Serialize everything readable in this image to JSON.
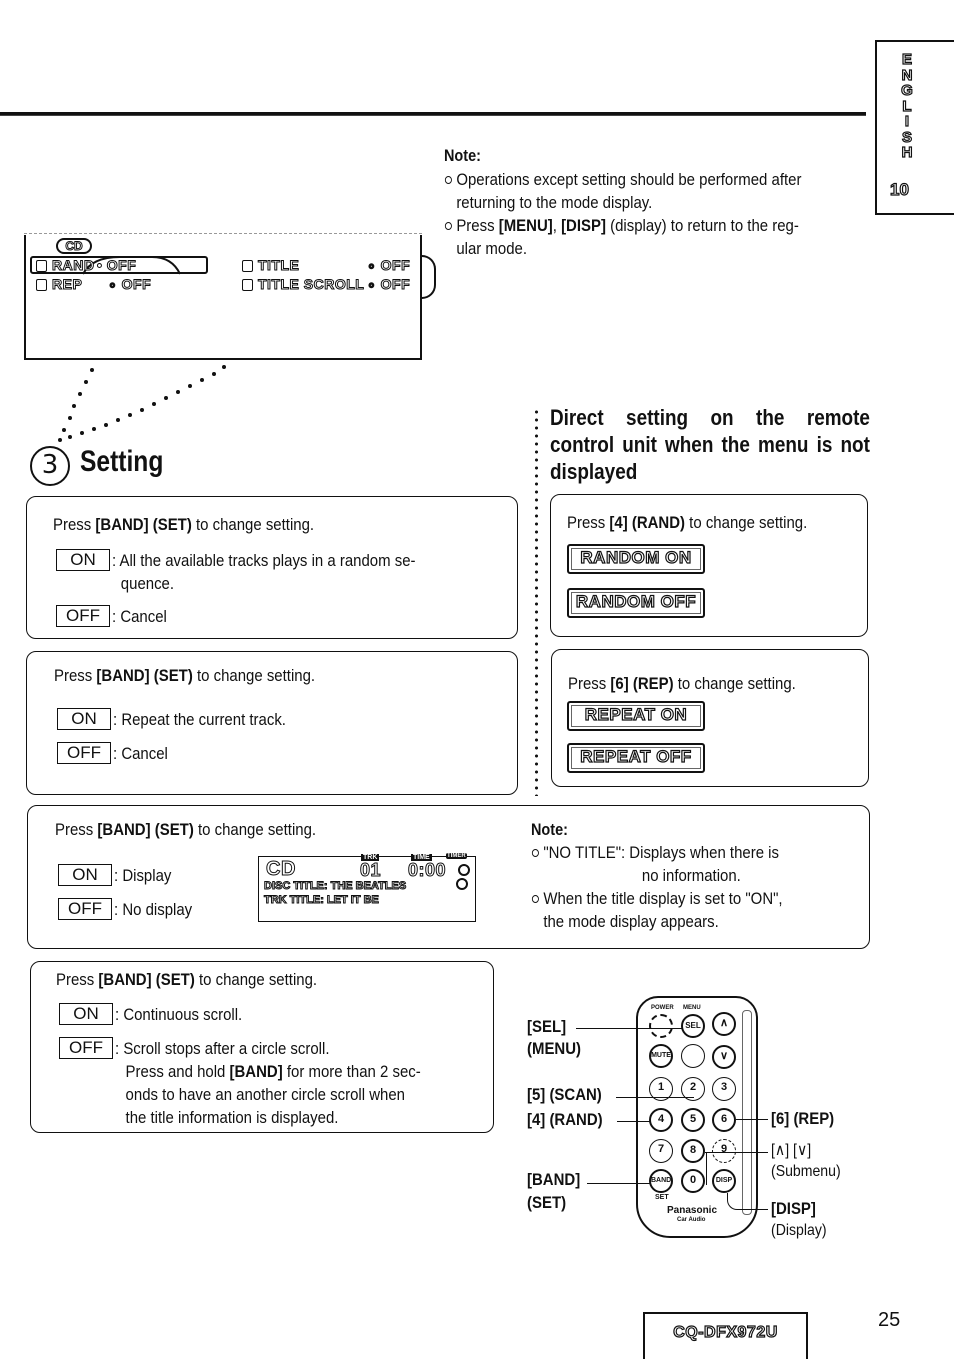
{
  "side_tab": {
    "letters": [
      "E",
      "N",
      "G",
      "L",
      "I",
      "S",
      "H"
    ],
    "page": "10"
  },
  "top_note": {
    "title": "Note:",
    "items": [
      "Operations except setting should be performed after returning to the mode display.",
      "Press [MENU], [DISP] (display) to return to the regular mode."
    ],
    "item2_parts": {
      "pre": "Press ",
      "b1": "[MENU]",
      "mid": ", ",
      "b2": "[DISP]",
      "post": " (display) to return to the reg-",
      "line2": "ular mode."
    },
    "item1_lines": [
      "Operations except setting should be performed after",
      "returning to the mode display."
    ]
  },
  "menu_lcd": {
    "cd": "CD",
    "rand": "RAND",
    "rand_value": "• OFF",
    "rep": "REP",
    "rep_value": "OFF",
    "title": "TITLE",
    "title_value": "OFF",
    "title_scroll": "TITLE SCROLL",
    "title_scroll_value": "OFF"
  },
  "section": {
    "number": "3",
    "title": "Setting"
  },
  "remote_heading": "Direct setting on the remote control unit when the menu is not displayed",
  "boxes": {
    "rand": {
      "press_pre": "Press ",
      "press_b": "[BAND] (SET)",
      "press_post": " to change setting.",
      "on_tag": "ON",
      "on_text": ": All the available tracks plays in a random se-",
      "on_text2": "quence.",
      "off_tag": "OFF",
      "off_text": ": Cancel"
    },
    "rep": {
      "press_pre": "Press ",
      "press_b": "[BAND] (SET)",
      "press_post": " to change setting.",
      "on_tag": "ON",
      "on_text": ": Repeat the current track.",
      "off_tag": "OFF",
      "off_text": ": Cancel"
    },
    "title": {
      "press_pre": "Press ",
      "press_b": "[BAND] (SET)",
      "press_post": " to change setting.",
      "on_tag": "ON",
      "on_text": ": Display",
      "off_tag": "OFF",
      "off_text": ": No display"
    },
    "scroll": {
      "press_pre": "Press ",
      "press_b": "[BAND] (SET)",
      "press_post": " to change setting.",
      "on_tag": "ON",
      "on_text": ": Continuous scroll.",
      "off_tag": "OFF",
      "off_text": ":  Scroll stops after a circle scroll.",
      "off_l2_pre": "Press and hold ",
      "off_l2_b": "[BAND]",
      "off_l2_post": " for more than 2 sec-",
      "off_l3": "onds to have an another circle scroll when",
      "off_l4": "the title information is displayed."
    },
    "remote_rand": {
      "press_pre": "Press ",
      "press_b": "[4] (RAND)",
      "press_post": " to change setting.",
      "lcd_on": "RANDOM ON",
      "lcd_off": "RANDOM OFF"
    },
    "remote_rep": {
      "press_pre": "Press ",
      "press_b": "[6] (REP)",
      "press_post": " to change setting.",
      "lcd_on": "REPEAT ON",
      "lcd_off": "REPEAT OFF"
    }
  },
  "title_lcd": {
    "cd": "CD",
    "trk_label": "TRK",
    "track": "01",
    "time_label": "TIME",
    "time": "0:00",
    "corner": "TIMER",
    "line1": "DISC TITLE: THE BEATLES",
    "line2": "TRK TITLE: LET IT BE"
  },
  "title_note": {
    "title": "Note:",
    "item1_a": "\"NO TITLE\": Displays  when  there  is",
    "item1_b": "no information.",
    "item2_a": "When the title display is set to \"ON\",",
    "item2_b": "the mode display appears."
  },
  "remote": {
    "labels": {
      "sel": "[SEL]",
      "menu": "(MENU)",
      "scan": "[5] (SCAN)",
      "rand": "[4] (RAND)",
      "band": "[BAND]",
      "set": "(SET)",
      "rep": "[6] (REP)",
      "updown": "[∧] [∨]",
      "submenu": "(Submenu)",
      "disp": "[DISP]",
      "display": "(Display)"
    },
    "keys": {
      "power": "POWER",
      "menu": "MENU",
      "sel": "SEL",
      "mute": "MUTE",
      "up": "∧",
      "down": "∨",
      "k1": "1",
      "k2": "2",
      "k3": "3",
      "k4": "4",
      "k5": "5",
      "k6": "6",
      "k7": "7",
      "k8": "8",
      "k9": "9",
      "k0": "0",
      "band": "BAND",
      "disp": "DISP",
      "set": "SET",
      "brand": "Panasonic",
      "sub": "Car Audio"
    }
  },
  "footer": {
    "model": "CQ-DFX972U",
    "page": "25"
  }
}
